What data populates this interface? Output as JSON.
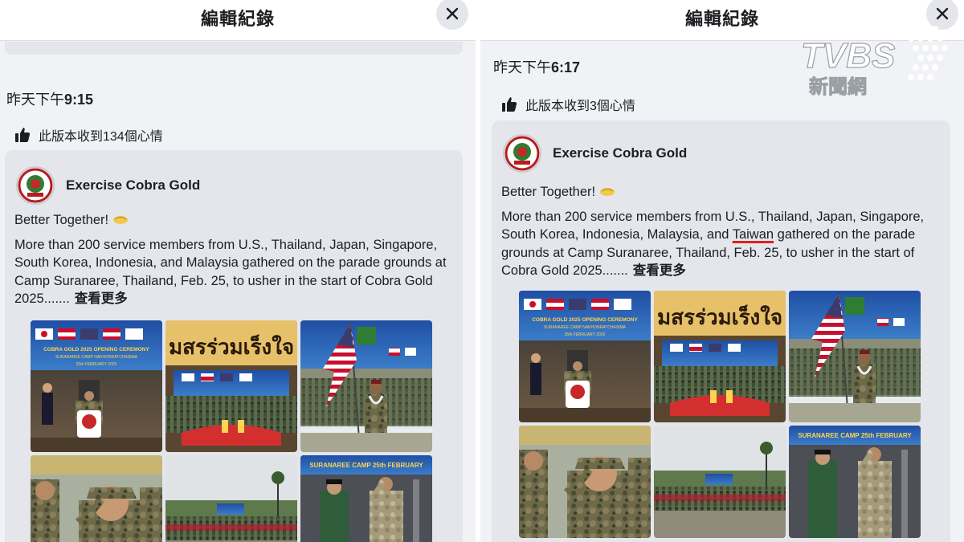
{
  "panels": [
    {
      "dialog_title": "編輯紀錄",
      "timestamp_prefix": "昨天下午",
      "timestamp_time": "9:15",
      "reactions_text": "此版本收到134個心情",
      "page_name": "Exercise Cobra Gold",
      "post_line1": "Better Together!",
      "post_body_a": "More than 200 service members from U.S., Thailand, Japan, Singapore, South Korea, Indonesia, and Malaysia gathered on the parade grounds at Camp Suranaree, Thailand, Feb. 25, to usher in the start of Cobra Gold 2025.......",
      "post_body_taiwan": "",
      "post_body_b": "",
      "see_more": "查看更多"
    },
    {
      "dialog_title": "編輯紀錄",
      "timestamp_prefix": "昨天下午",
      "timestamp_time": "6:17",
      "reactions_text": "此版本收到3個心情",
      "page_name": "Exercise Cobra Gold",
      "post_line1": "Better Together!",
      "post_body_a": "More than 200 service members from U.S., Thailand, Japan, Singapore, South Korea, Indonesia, Malaysia, and ",
      "post_body_taiwan": "Taiwan",
      "post_body_b": " gathered on the parade grounds at Camp Suranaree, Thailand, Feb. 25, to usher in the start of Cobra Gold 2025.......",
      "see_more": "查看更多"
    }
  ],
  "photo_texts": {
    "banner_line1": "COBRA GOLD 2025 OPENING CEREMONY",
    "banner_line2": "SURANAREE CAMP NAKHONRATCHASIMA",
    "banner_line3": "25th FEBRUARY 2025",
    "thai_sign": "มสรร่วมเร็งใจ",
    "stage_banner": "SURANAREE CAMP 25th FEBRUARY"
  },
  "watermark": {
    "logo_text": "TVBS",
    "sub_text": "新聞網"
  },
  "icons": {
    "close": "close-icon",
    "reaction": "thumbs-up-icon",
    "emoji": "handshake-emoji-icon"
  },
  "colors": {
    "panel_bg": "#f0f2f5",
    "card_bg": "#e4e6eb",
    "highlight_underline": "#e02020"
  }
}
